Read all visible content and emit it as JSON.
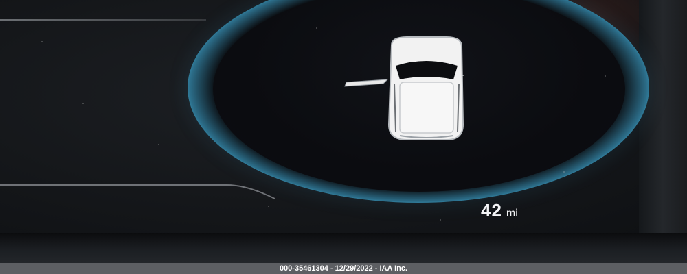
{
  "display": {
    "range_value": "42",
    "range_unit": "mi",
    "accent_color": "#3fa9cf"
  },
  "icons": {
    "vehicle": "car-top-view-icon",
    "door": "door-open-icon"
  },
  "watermark": {
    "text": "000-35461304 - 12/29/2022 - IAA Inc."
  }
}
